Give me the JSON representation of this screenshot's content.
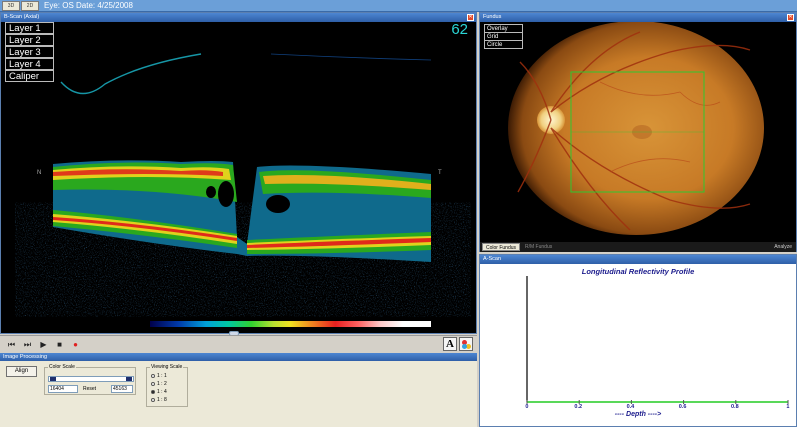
{
  "topbar": {
    "mode_tabs": [
      "3D",
      "2D"
    ],
    "eye_info": "Eye: OS  Date: 4/25/2008"
  },
  "bscan": {
    "title": "B-Scan (Axial)",
    "layer_buttons": [
      "Layer 1",
      "Layer 2",
      "Layer 3",
      "Layer 4",
      "Caliper"
    ],
    "frame_number": "62",
    "left_marker": "N",
    "right_marker": "T",
    "close_symbol": "✕"
  },
  "transport": {
    "buttons": [
      "skip-back",
      "step-forward",
      "play",
      "stop",
      "record"
    ],
    "font_button_label": "A"
  },
  "image_processing": {
    "title": "Image Processing",
    "align_label": "Align",
    "color_scale_label": "Color Scale",
    "color_min": "16404",
    "reset_label": "Reset",
    "color_max": "45163",
    "viewing_scale_label": "Viewing Scale",
    "viewing_options": [
      "1 : 1",
      "1 : 2",
      "1 : 4",
      "1 : 8"
    ],
    "viewing_selected": "1 : 4"
  },
  "fundus": {
    "title": "Fundus",
    "close_symbol": "✕",
    "menu": [
      "Overlay",
      "Grid",
      "Circle"
    ],
    "tabs": [
      "Color Fundus",
      "R/M Fundus"
    ],
    "active_tab": "Color Fundus",
    "analyze_label": "Analyze"
  },
  "ascan": {
    "title": "A-Scan",
    "chart_title": "Longitudinal Reflectivity Profile",
    "depth_label": "---- Depth ---->"
  },
  "chart_data": {
    "type": "line",
    "title": "Longitudinal Reflectivity Profile",
    "xlabel": "---- Depth ---->",
    "ylabel": "",
    "xlim": [
      0,
      1
    ],
    "x_ticks": [
      "0",
      "0.2",
      "0.4",
      "0.6",
      "0.8",
      "1"
    ],
    "series": [
      {
        "x": [
          0,
          1
        ],
        "values": [
          0,
          0
        ]
      }
    ]
  },
  "colors": {
    "title_bar": "#2e5fa8",
    "frame_number": "#2bd6d6",
    "profile_line": "#22cc22",
    "axis_text": "#1a1a8c",
    "guide_box": "#2fc82f"
  }
}
